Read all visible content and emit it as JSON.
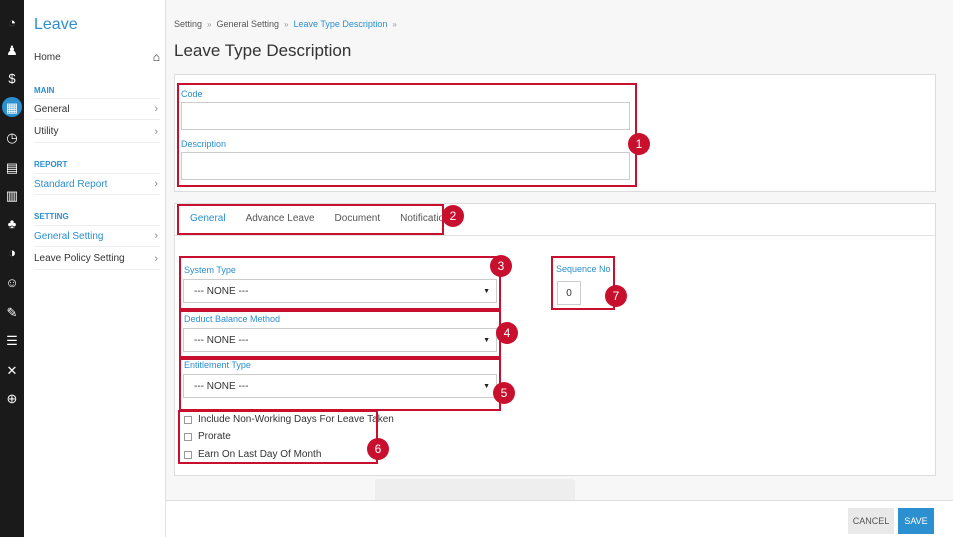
{
  "sidebar": {
    "title": "Leave",
    "home": "Home",
    "sections": {
      "main": "MAIN",
      "report": "REPORT",
      "setting": "SETTING"
    },
    "items": {
      "general": "General",
      "utility": "Utility",
      "standard_report": "Standard Report",
      "general_setting": "General Setting",
      "leave_policy_setting": "Leave Policy Setting"
    }
  },
  "breadcrumb": {
    "level1": "Setting",
    "level2": "General Setting",
    "level3": "Leave Type Description",
    "separator": "»"
  },
  "page_title": "Leave Type Description",
  "form": {
    "code_label": "Code",
    "description_label": "Description",
    "tabs": [
      "General",
      "Advance Leave",
      "Document",
      "Notification"
    ],
    "system_type_label": "System Type",
    "system_type_value": "--- NONE ---",
    "deduct_label": "Deduct Balance Method",
    "deduct_value": "--- NONE ---",
    "entitlement_label": "Entitlement Type",
    "entitlement_value": "--- NONE ---",
    "sequence_label": "Sequence No",
    "sequence_value": "0",
    "checkboxes": [
      "Include Non-Working Days For Leave Taken",
      "Prorate",
      "Earn On Last Day Of Month"
    ]
  },
  "annotations": [
    "1",
    "2",
    "3",
    "4",
    "5",
    "6",
    "7"
  ],
  "footer": {
    "cancel": "CANCEL",
    "save": "SAVE"
  },
  "colors": {
    "accent": "#2b8fd0",
    "annotation": "#c8102e",
    "rail": "#1a1a1a"
  }
}
